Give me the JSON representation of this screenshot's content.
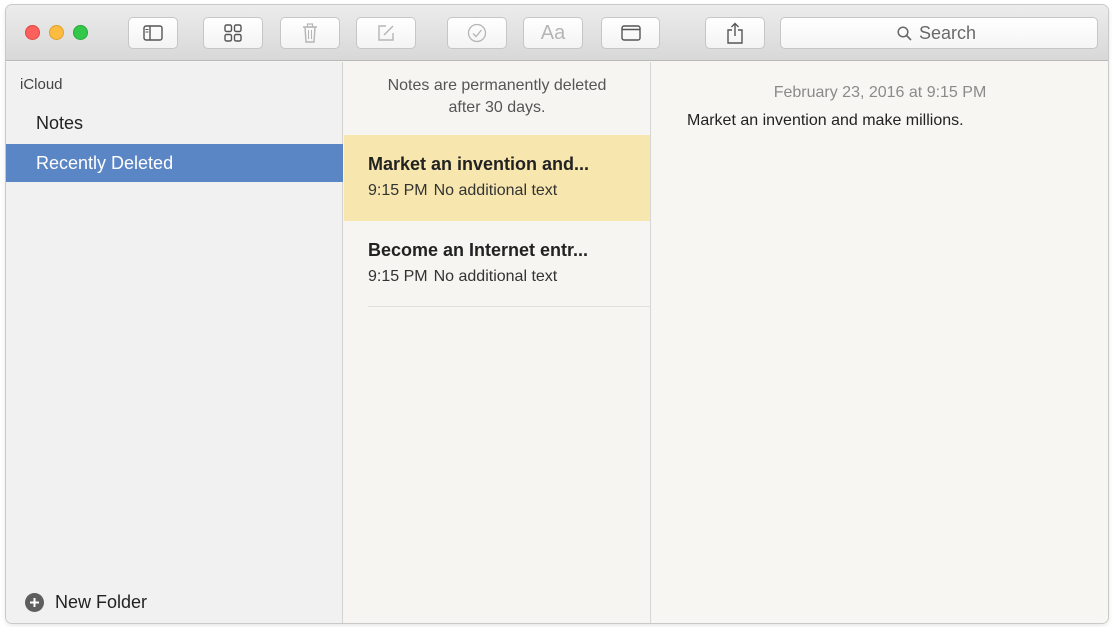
{
  "toolbar": {
    "buttons": [
      {
        "name": "sidebar-toggle",
        "icon": "sidebar-icon"
      },
      {
        "name": "grid-view",
        "icon": "grid-icon"
      },
      {
        "name": "delete",
        "icon": "trash-icon"
      },
      {
        "name": "compose",
        "icon": "compose-icon"
      },
      {
        "name": "checklist",
        "icon": "checkmark-circle-icon"
      },
      {
        "name": "format",
        "icon": "aa-icon",
        "label": "Aa"
      },
      {
        "name": "attachments",
        "icon": "window-icon"
      },
      {
        "name": "share",
        "icon": "share-icon"
      }
    ],
    "search_placeholder": "Search"
  },
  "sidebar": {
    "account": "iCloud",
    "items": [
      {
        "label": "Notes",
        "selected": false
      },
      {
        "label": "Recently Deleted",
        "selected": true
      }
    ],
    "new_folder_label": "New Folder"
  },
  "note_list": {
    "banner_line1": "Notes are permanently deleted",
    "banner_line2": "after 30 days.",
    "notes": [
      {
        "title": "Market an invention and...",
        "time": "9:15 PM",
        "preview": "No additional text",
        "selected": true
      },
      {
        "title": "Become an Internet entr...",
        "time": "9:15 PM",
        "preview": "No additional text",
        "selected": false
      }
    ]
  },
  "editor": {
    "date": "February 23, 2016 at 9:15 PM",
    "body": "Market an invention and make millions."
  },
  "colors": {
    "selection_blue": "#5b86c6",
    "selected_note": "#f7e6ae",
    "close": "#fc605c",
    "minimize": "#fdbc40",
    "zoom": "#34c84a"
  }
}
